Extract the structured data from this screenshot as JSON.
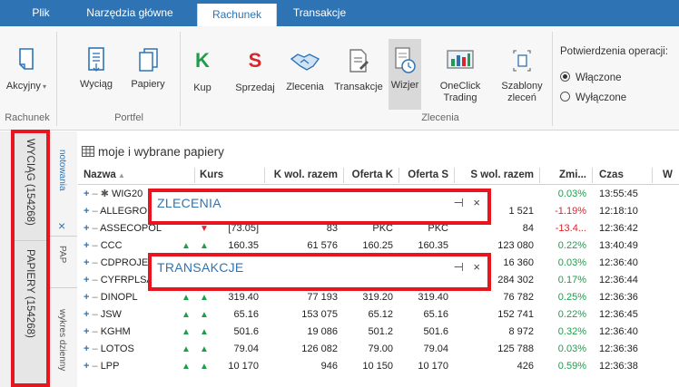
{
  "ribbon_tabs": [
    "Plik",
    "Narzędzia główne",
    "Rachunek",
    "Transakcje"
  ],
  "active_tab": "Rachunek",
  "ribbon": {
    "akcyjny_label": "Akcyjny",
    "rachunek_group": "Rachunek",
    "wyciag_label": "Wyciąg",
    "papiery_label": "Papiery",
    "portfel_group": "Portfel",
    "kup_letter": "K",
    "kup_label": "Kup",
    "sprzedaj_letter": "S",
    "sprzedaj_label": "Sprzedaj",
    "zlecenia_label": "Zlecenia",
    "transakcje_label": "Transakcje",
    "wizjer_label": "Wizjer",
    "oneclick_label1": "OneClick",
    "oneclick_label2": "Trading",
    "szablony_label1": "Szablony",
    "szablony_label2": "zleceń",
    "zlecenia_group": "Zlecenia",
    "confirm_title": "Potwierdzenia operacji:",
    "confirm_on": "Włączone",
    "confirm_off": "Wyłączone"
  },
  "side_tabs": {
    "wyciag": "WYCIĄG (154268)",
    "papiery": "PAPIERY (154268)",
    "notowania": "notowania",
    "close": "×",
    "pap": "PAP",
    "wykres": "wykres dzienny"
  },
  "grid": {
    "title": "moje i wybrane papiery",
    "columns": [
      "Nazwa",
      "Kurs",
      "K wol. razem",
      "Oferta K",
      "Oferta S",
      "S wol. razem",
      "Zmi...",
      "Czas",
      "W"
    ],
    "rows": [
      {
        "name": "WIG20",
        "pin": "✱",
        "arrow1": "",
        "arrow2": "",
        "kurs": "",
        "kwol": "",
        "ofk": "",
        "ofs": "",
        "swol": "",
        "zmi": "0.03%",
        "czas": "13:55:45"
      },
      {
        "name": "ALLEGRO",
        "pin": "",
        "arrow1": "",
        "arrow2": "",
        "kurs": "",
        "kwol": "",
        "ofk": "",
        "ofs": "",
        "swol": "1 521",
        "zmi": "-1.19%",
        "czas": "12:18:10"
      },
      {
        "name": "ASSECOPOL",
        "pin": "",
        "arrow1": "",
        "arrow2": "down",
        "kurs": "[73.05]",
        "kwol": "83",
        "ofk": "PKC",
        "ofs": "PKC",
        "swol": "84",
        "zmi": "-13.4...",
        "czas": "12:36:42"
      },
      {
        "name": "CCC",
        "pin": "",
        "arrow1": "up",
        "arrow2": "up",
        "kurs": "160.35",
        "kwol": "61 576",
        "ofk": "160.25",
        "ofs": "160.35",
        "swol": "123 080",
        "zmi": "0.22%",
        "czas": "13:40:49"
      },
      {
        "name": "CDPROJEKT",
        "pin": "",
        "arrow1": "",
        "arrow2": "",
        "kurs": "",
        "kwol": "",
        "ofk": "",
        "ofs": "",
        "swol": "16 360",
        "zmi": "0.03%",
        "czas": "12:36:40"
      },
      {
        "name": "CYFRPLSAT",
        "pin": "",
        "arrow1": "",
        "arrow2": "",
        "kurs": "",
        "kwol": "",
        "ofk": "",
        "ofs": "",
        "swol": "284 302",
        "zmi": "0.17%",
        "czas": "12:36:44"
      },
      {
        "name": "DINOPL",
        "pin": "",
        "arrow1": "up",
        "arrow2": "up",
        "kurs": "319.40",
        "kwol": "77 193",
        "ofk": "319.20",
        "ofs": "319.40",
        "swol": "76 782",
        "zmi": "0.25%",
        "czas": "12:36:36"
      },
      {
        "name": "JSW",
        "pin": "",
        "arrow1": "up",
        "arrow2": "up",
        "kurs": "65.16",
        "kwol": "153 075",
        "ofk": "65.12",
        "ofs": "65.16",
        "swol": "152 741",
        "zmi": "0.22%",
        "czas": "12:36:45"
      },
      {
        "name": "KGHM",
        "pin": "",
        "arrow1": "up",
        "arrow2": "up",
        "kurs": "501.6",
        "kwol": "19 086",
        "ofk": "501.2",
        "ofs": "501.6",
        "swol": "8 972",
        "zmi": "0.32%",
        "czas": "12:36:40"
      },
      {
        "name": "LOTOS",
        "pin": "",
        "arrow1": "up",
        "arrow2": "up",
        "kurs": "79.04",
        "kwol": "126 082",
        "ofk": "79.00",
        "ofs": "79.04",
        "swol": "125 788",
        "zmi": "0.03%",
        "czas": "12:36:36"
      },
      {
        "name": "LPP",
        "pin": "",
        "arrow1": "up",
        "arrow2": "up",
        "kurs": "10 170",
        "kwol": "946",
        "ofk": "10 150",
        "ofs": "10 170",
        "swol": "426",
        "zmi": "0.59%",
        "czas": "12:36:38"
      }
    ]
  },
  "panels": {
    "zlecenia": {
      "title": "ZLECENIA",
      "pin": "⊣",
      "close": "×"
    },
    "transakcje": {
      "title": "TRANSAKCJE",
      "pin": "⊣",
      "close": "×"
    }
  },
  "colors": {
    "accent": "#2e74b5",
    "highlight": "#e8141e",
    "up": "#1e9e4a",
    "down": "#d9262c"
  }
}
